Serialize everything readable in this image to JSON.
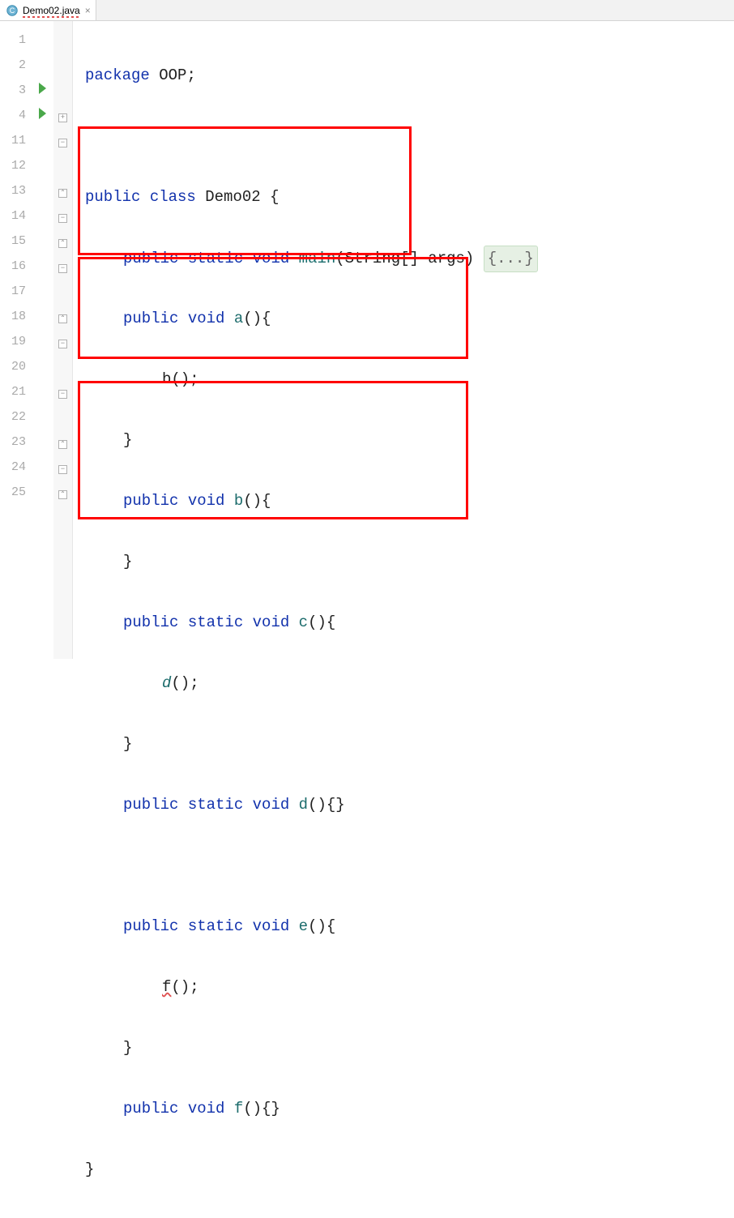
{
  "tab": {
    "filename": "Demo02.java"
  },
  "lines": {
    "nums": [
      "1",
      "2",
      "3",
      "4",
      "11",
      "12",
      "13",
      "14",
      "15",
      "16",
      "17",
      "18",
      "19",
      "20",
      "21",
      "22",
      "23",
      "24",
      "25"
    ],
    "run_markers": {
      "3": true,
      "4": true
    },
    "fold": {
      "4": "plus",
      "5": "minus",
      "7": "up",
      "8": "minus",
      "9": "up",
      "10": "minus",
      "12": "up",
      "13": "minus",
      "15": "minus",
      "17": "up",
      "18": "minus",
      "19": "up"
    }
  },
  "code": {
    "l1": {
      "kw_package": "package",
      "pkg": "OOP",
      "semi": ";"
    },
    "l3": {
      "kw_public": "public",
      "kw_class": "class",
      "name": "Demo02",
      "brace": "{"
    },
    "l4": {
      "kw_public": "public",
      "kw_static": "static",
      "kw_void": "void",
      "m": "main",
      "params": "(String[] args)",
      "folded": "{...}"
    },
    "l11": {
      "kw_public": "public",
      "kw_void": "void",
      "m": "a",
      "rest": "(){"
    },
    "l12": {
      "call": "b();"
    },
    "l13": {
      "brace": "}"
    },
    "l14": {
      "kw_public": "public",
      "kw_void": "void",
      "m": "b",
      "rest": "(){"
    },
    "l15": {
      "brace": "}"
    },
    "l16": {
      "kw_public": "public",
      "kw_static": "static",
      "kw_void": "void",
      "m": "c",
      "rest": "(){"
    },
    "l17": {
      "call": "d",
      "rest": "();"
    },
    "l18": {
      "brace": "}"
    },
    "l19": {
      "kw_public": "public",
      "kw_static": "static",
      "kw_void": "void",
      "m": "d",
      "rest": "(){}"
    },
    "l21": {
      "kw_public": "public",
      "kw_static": "static",
      "kw_void": "void",
      "m": "e",
      "rest": "(){"
    },
    "l22": {
      "call": "f",
      "rest": "();"
    },
    "l23": {
      "brace": "}"
    },
    "l24": {
      "kw_public": "public",
      "kw_void": "void",
      "m": "f",
      "rest": "(){}"
    },
    "l25": {
      "brace": "}"
    }
  }
}
